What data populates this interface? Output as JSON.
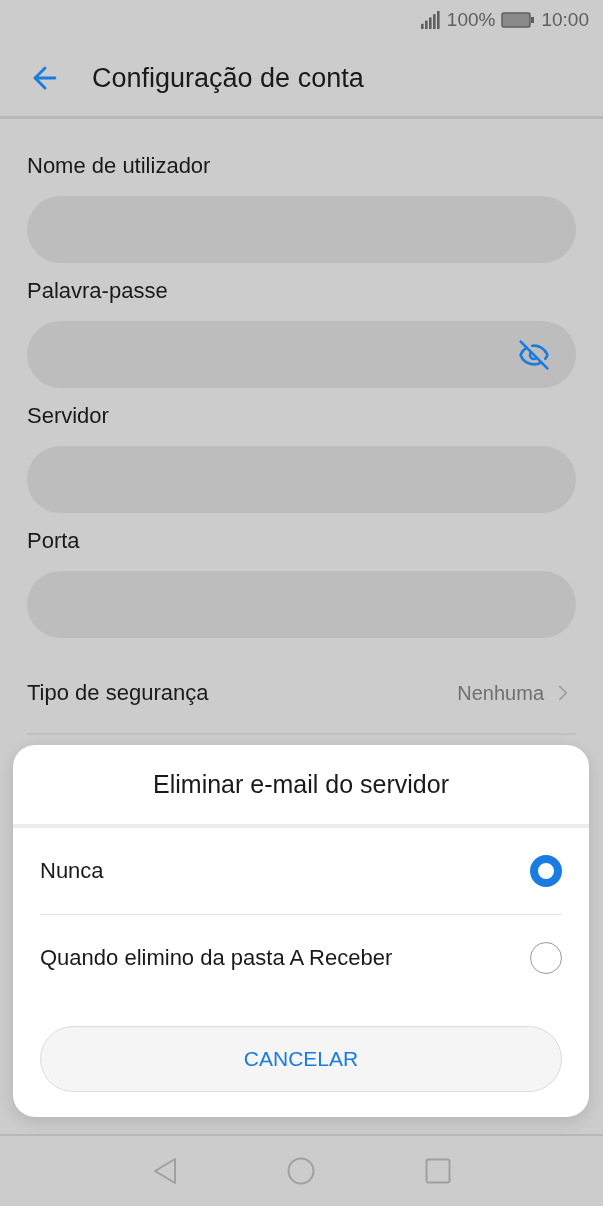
{
  "status_bar": {
    "battery_text": "100%",
    "time": "10:00"
  },
  "header": {
    "title": "Configuração de conta"
  },
  "fields": [
    {
      "label": "Nome de utilizador",
      "kind": "text"
    },
    {
      "label": "Palavra-passe",
      "kind": "password"
    },
    {
      "label": "Servidor",
      "kind": "text"
    },
    {
      "label": "Porta",
      "kind": "text"
    }
  ],
  "security": {
    "label": "Tipo de segurança",
    "value": "Nenhuma"
  },
  "dialog": {
    "title": "Eliminar e-mail do servidor",
    "options": [
      {
        "label": "Nunca",
        "selected": true
      },
      {
        "label": "Quando elimino da pasta A Receber",
        "selected": false
      }
    ],
    "cancel": "CANCELAR"
  }
}
